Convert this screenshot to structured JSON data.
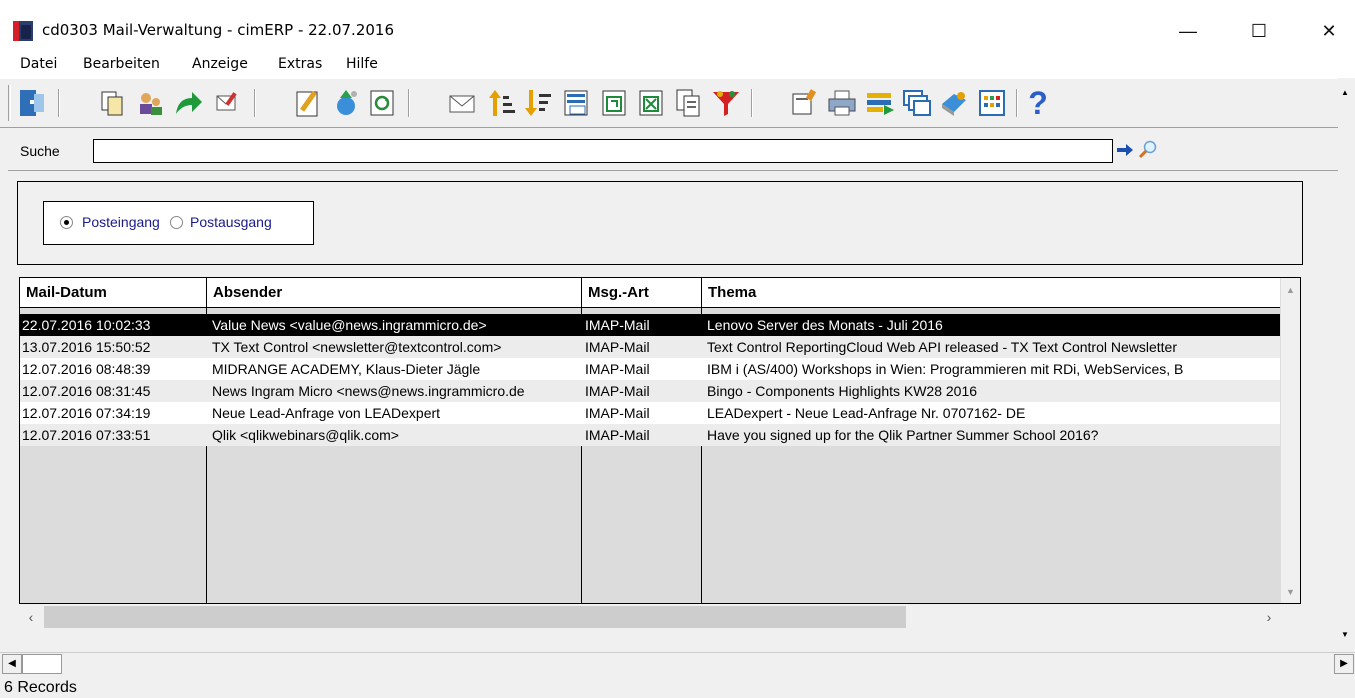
{
  "window": {
    "title": "cd0303 Mail-Verwaltung - cimERP - 22.07.2016",
    "minimize": "—",
    "maximize": "☐",
    "close": "✕"
  },
  "menu": [
    "Datei",
    "Bearbeiten",
    "Anzeige",
    "Extras",
    "Hilfe"
  ],
  "toolbar": {
    "icons": [
      "exit-icon",
      "copy-icon",
      "users-icon",
      "forward-icon",
      "edit-mail-icon",
      "pencil-icon",
      "refresh-wizard-icon",
      "reload-icon",
      "envelope-icon",
      "sort-ascending-icon",
      "sort-descending-icon",
      "calculator-icon",
      "export-icon",
      "excel-icon",
      "documents-icon",
      "filter-icon",
      "settings-icon",
      "printer-icon",
      "transfer-icon",
      "windows-icon",
      "book-icon",
      "calendar-icon",
      "help-icon"
    ],
    "help_glyph": "?"
  },
  "search": {
    "label": "Suche",
    "value": "",
    "go_icon": "arrow-right-icon",
    "find_icon": "magnifier-icon"
  },
  "filter": {
    "options": [
      {
        "label": "Posteingang",
        "selected": true
      },
      {
        "label": "Postausgang",
        "selected": false
      }
    ]
  },
  "grid": {
    "columns": [
      "Mail-Datum",
      "Absender",
      "Msg.-Art",
      "Thema"
    ],
    "rows": [
      {
        "date": "22.07.2016 10:02:33",
        "sender": "Value News <value@news.ingrammicro.de>",
        "type": "IMAP-Mail",
        "subject": "Lenovo Server des Monats - Juli 2016"
      },
      {
        "date": "13.07.2016 15:50:52",
        "sender": "TX Text Control <newsletter@textcontrol.com>",
        "type": "IMAP-Mail",
        "subject": "Text Control ReportingCloud Web API released - TX Text Control Newsletter"
      },
      {
        "date": "12.07.2016 08:48:39",
        "sender": "MIDRANGE ACADEMY, Klaus-Dieter Jägle",
        "type": "IMAP-Mail",
        "subject": "IBM i (AS/400) Workshops in Wien: Programmieren mit RDi, WebServices,  B"
      },
      {
        "date": "12.07.2016 08:31:45",
        "sender": "News Ingram Micro <news@news.ingrammicro.de",
        "type": "IMAP-Mail",
        "subject": "Bingo - Components Highlights KW28 2016"
      },
      {
        "date": "12.07.2016 07:34:19",
        "sender": "Neue Lead-Anfrage von LEADexpert",
        "type": "IMAP-Mail",
        "subject": "LEADexpert - Neue Lead-Anfrage Nr. 0707162- DE"
      },
      {
        "date": "12.07.2016 07:33:51",
        "sender": "Qlik <qlikwebinars@qlik.com>",
        "type": "IMAP-Mail",
        "subject": "Have you signed up for the Qlik Partner Summer School 2016?"
      }
    ],
    "selected_index": 0
  },
  "status": {
    "records": "6 Records"
  }
}
